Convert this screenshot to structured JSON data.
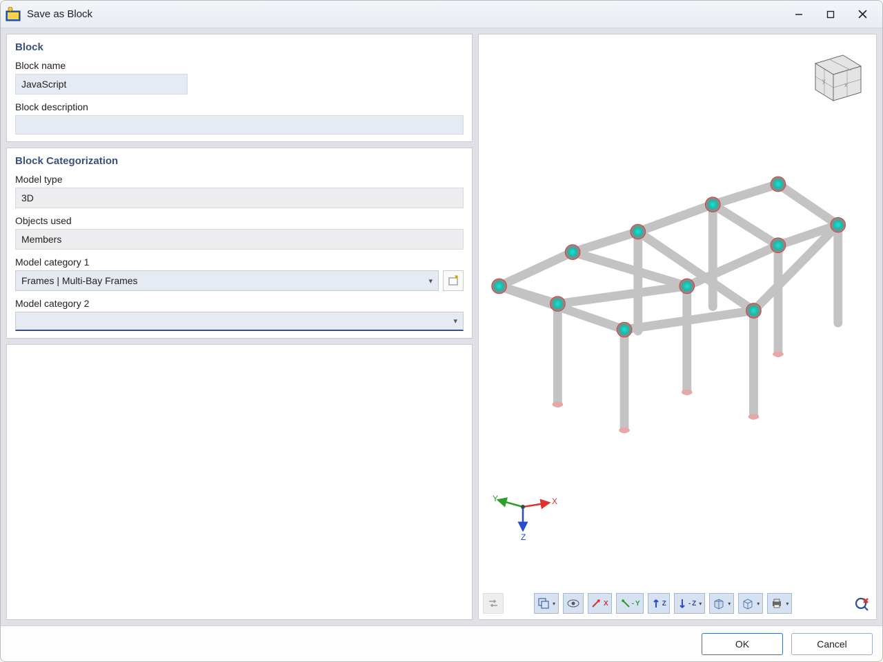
{
  "window": {
    "title": "Save as Block"
  },
  "sections": {
    "block": {
      "title": "Block",
      "name_label": "Block name",
      "name_value": "JavaScript",
      "desc_label": "Block description",
      "desc_value": ""
    },
    "categorization": {
      "title": "Block Categorization",
      "model_type_label": "Model type",
      "model_type_value": "3D",
      "objects_used_label": "Objects used",
      "objects_used_value": "Members",
      "cat1_label": "Model category 1",
      "cat1_value": "Frames | Multi-Bay Frames",
      "cat2_label": "Model category 2",
      "cat2_value": ""
    }
  },
  "axes": {
    "x": "X",
    "y": "Y",
    "z": "Z"
  },
  "toolbar": {
    "btn_swap": "swap-view",
    "btn_snap": "snap-settings",
    "btn_eye": "visibility",
    "dir_x": "+X",
    "dir_y": "-Y",
    "dir_zup": "↑Z",
    "dir_zdn": "-Z",
    "btn_box": "projection",
    "btn_wire": "wireframe",
    "btn_print": "print",
    "btn_reset": "reset-view"
  },
  "footer": {
    "ok": "OK",
    "cancel": "Cancel"
  }
}
